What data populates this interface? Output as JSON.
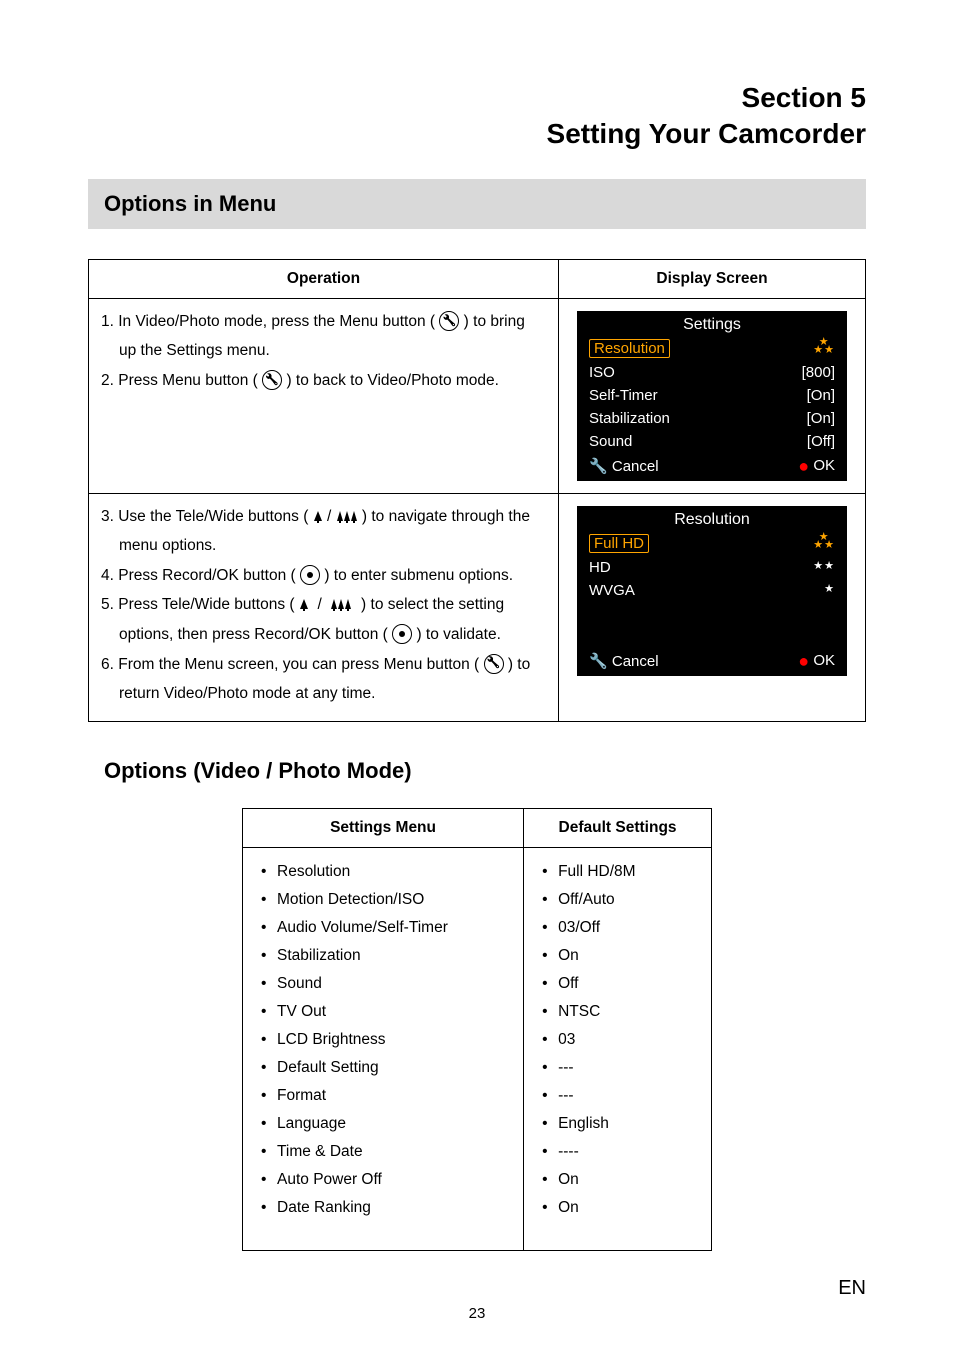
{
  "section": {
    "line1": "Section 5",
    "line2": "Setting Your Camcorder"
  },
  "h1": "Options in Menu",
  "opTable": {
    "head": {
      "col1": "Operation",
      "col2": "Display Screen"
    },
    "row1": {
      "step1a": "1. In Video/Photo mode, press the Menu button (",
      "step1b": ") to bring",
      "step1c": "up the Settings menu.",
      "step2a": "2. Press Menu button (",
      "step2b": ") to back to Video/Photo mode."
    },
    "lcd1": {
      "title": "Settings",
      "rows": [
        {
          "label": "Resolution",
          "value": ""
        },
        {
          "label": "ISO",
          "value": "[800]"
        },
        {
          "label": "Self-Timer",
          "value": "[On]"
        },
        {
          "label": "Stabilization",
          "value": "[On]"
        },
        {
          "label": "Sound",
          "value": "[Off]"
        }
      ],
      "cancel": "Cancel",
      "ok": "OK"
    },
    "row2": {
      "step3a": "3. Use the Tele/Wide buttons (",
      "step3b": ") to navigate through the",
      "step3c": "menu options.",
      "step4a": "4. Press Record/OK button (",
      "step4b": ") to enter submenu options.",
      "step5a": "5. Press Tele/Wide buttons (",
      "step5b": ") to select the setting",
      "step5c": "options, then press Record/OK button (",
      "step5d": ") to validate.",
      "step6a": "6. From the Menu screen, you can press Menu button (",
      "step6b": ") to",
      "step6c": "return Video/Photo mode at any time."
    },
    "lcd2": {
      "title": "Resolution",
      "rows": [
        {
          "label": "Full HD",
          "stars": 3
        },
        {
          "label": "HD",
          "stars": 2
        },
        {
          "label": "WVGA",
          "stars": 1
        }
      ],
      "cancel": "Cancel",
      "ok": "OK"
    }
  },
  "h2": "Options (Video / Photo Mode)",
  "settingsTable": {
    "head": {
      "col1": "Settings Menu",
      "col2": "Default Settings"
    },
    "menu": [
      "Resolution",
      "Motion Detection/ISO",
      "Audio Volume/Self-Timer",
      "Stabilization",
      "Sound",
      "TV Out",
      "LCD Brightness",
      "Default Setting",
      "Format",
      "Language",
      "Time & Date",
      "Auto Power Off",
      "Date Ranking"
    ],
    "defaults": [
      "Full HD/8M",
      "Off/Auto",
      "03/Off",
      "On",
      "Off",
      "NTSC",
      "03",
      "---",
      "---",
      "English",
      "----",
      "On",
      "On"
    ]
  },
  "footer": {
    "page": "23",
    "lang": "EN"
  }
}
